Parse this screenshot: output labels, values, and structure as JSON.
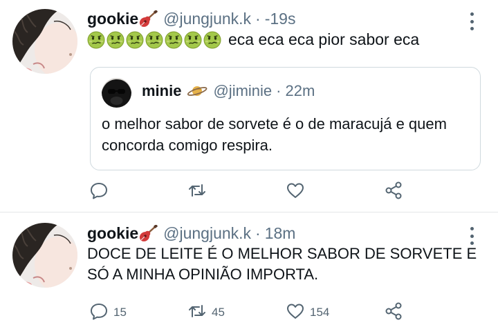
{
  "tweets": [
    {
      "display_name": "gookie",
      "handle": "@jungjunk.k",
      "separator": "·",
      "time": "-19s",
      "text": "eca eca eca pior sabor eca",
      "emoji_count": 7,
      "emoji_icon": "nauseated-face-icon",
      "name_icon": "guitar-icon",
      "quote": {
        "display_name": "minie",
        "name_icon": "ringed-planet-icon",
        "handle": "@jiminie",
        "separator": "·",
        "time": "22m",
        "text": "o melhor sabor de sorvete é o de maracujá e quem concorda comigo respira."
      },
      "actions": {
        "replies": "",
        "retweets": "",
        "likes": ""
      }
    },
    {
      "display_name": "gookie",
      "handle": "@jungjunk.k",
      "separator": "·",
      "time": "18m",
      "text": "DOCE DE LEITE É O MELHOR SABOR DE SORVETE E SÓ A MINHA OPINIÃO IMPORTA.",
      "name_icon": "guitar-icon",
      "actions": {
        "replies": "15",
        "retweets": "45",
        "likes": "154"
      }
    }
  ],
  "icons": {
    "reply": "speech-bubble-icon",
    "retweet": "retweet-arrows-icon",
    "like": "heart-icon",
    "share": "share-nodes-icon",
    "more": "vertical-ellipsis-icon"
  },
  "colors": {
    "text": "#0f1419",
    "muted": "#5b7083",
    "border": "#cfd9de",
    "emoji_face": "#a3c84a"
  }
}
